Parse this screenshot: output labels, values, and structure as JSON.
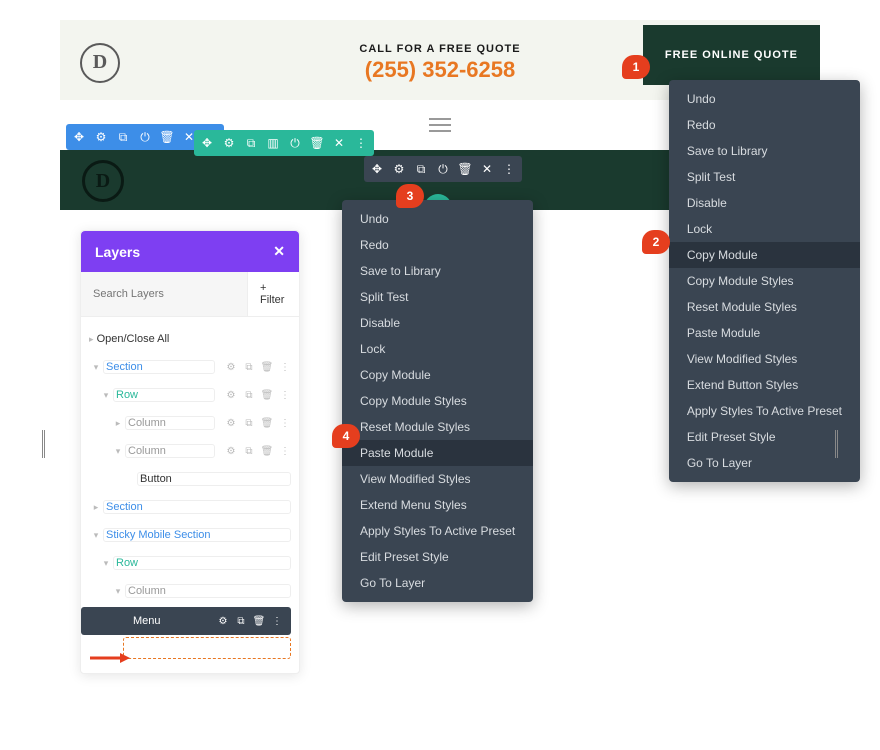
{
  "top": {
    "quote_label": "CALL FOR A FREE QUOTE",
    "phone": "(255) 352-6258",
    "button": "FREE ONLINE QUOTE"
  },
  "callouts": {
    "c1": "1",
    "c2": "2",
    "c3": "3",
    "c4": "4"
  },
  "ctx_right": {
    "items": [
      "Undo",
      "Redo",
      "Save to Library",
      "Split Test",
      "Disable",
      "Lock",
      "Copy Module",
      "Copy Module Styles",
      "Reset Module Styles",
      "Paste Module",
      "View Modified Styles",
      "Extend Button Styles",
      "Apply Styles To Active Preset",
      "Edit Preset Style",
      "Go To Layer"
    ],
    "highlight": 6
  },
  "ctx_left": {
    "items": [
      "Undo",
      "Redo",
      "Save to Library",
      "Split Test",
      "Disable",
      "Lock",
      "Copy Module",
      "Copy Module Styles",
      "Reset Module Styles",
      "Paste Module",
      "View Modified Styles",
      "Extend Menu Styles",
      "Apply Styles To Active Preset",
      "Edit Preset Style",
      "Go To Layer"
    ],
    "highlight": 9
  },
  "layers": {
    "title": "Layers",
    "search_placeholder": "Search Layers",
    "filter": "+ Filter",
    "open_close": "Open/Close All",
    "tree": {
      "section1": "Section",
      "row1": "Row",
      "col1": "Column",
      "col2": "Column",
      "button": "Button",
      "section2": "Section",
      "sticky": "Sticky Mobile Section",
      "row2": "Row",
      "col3": "Column",
      "menu": "Menu"
    }
  }
}
